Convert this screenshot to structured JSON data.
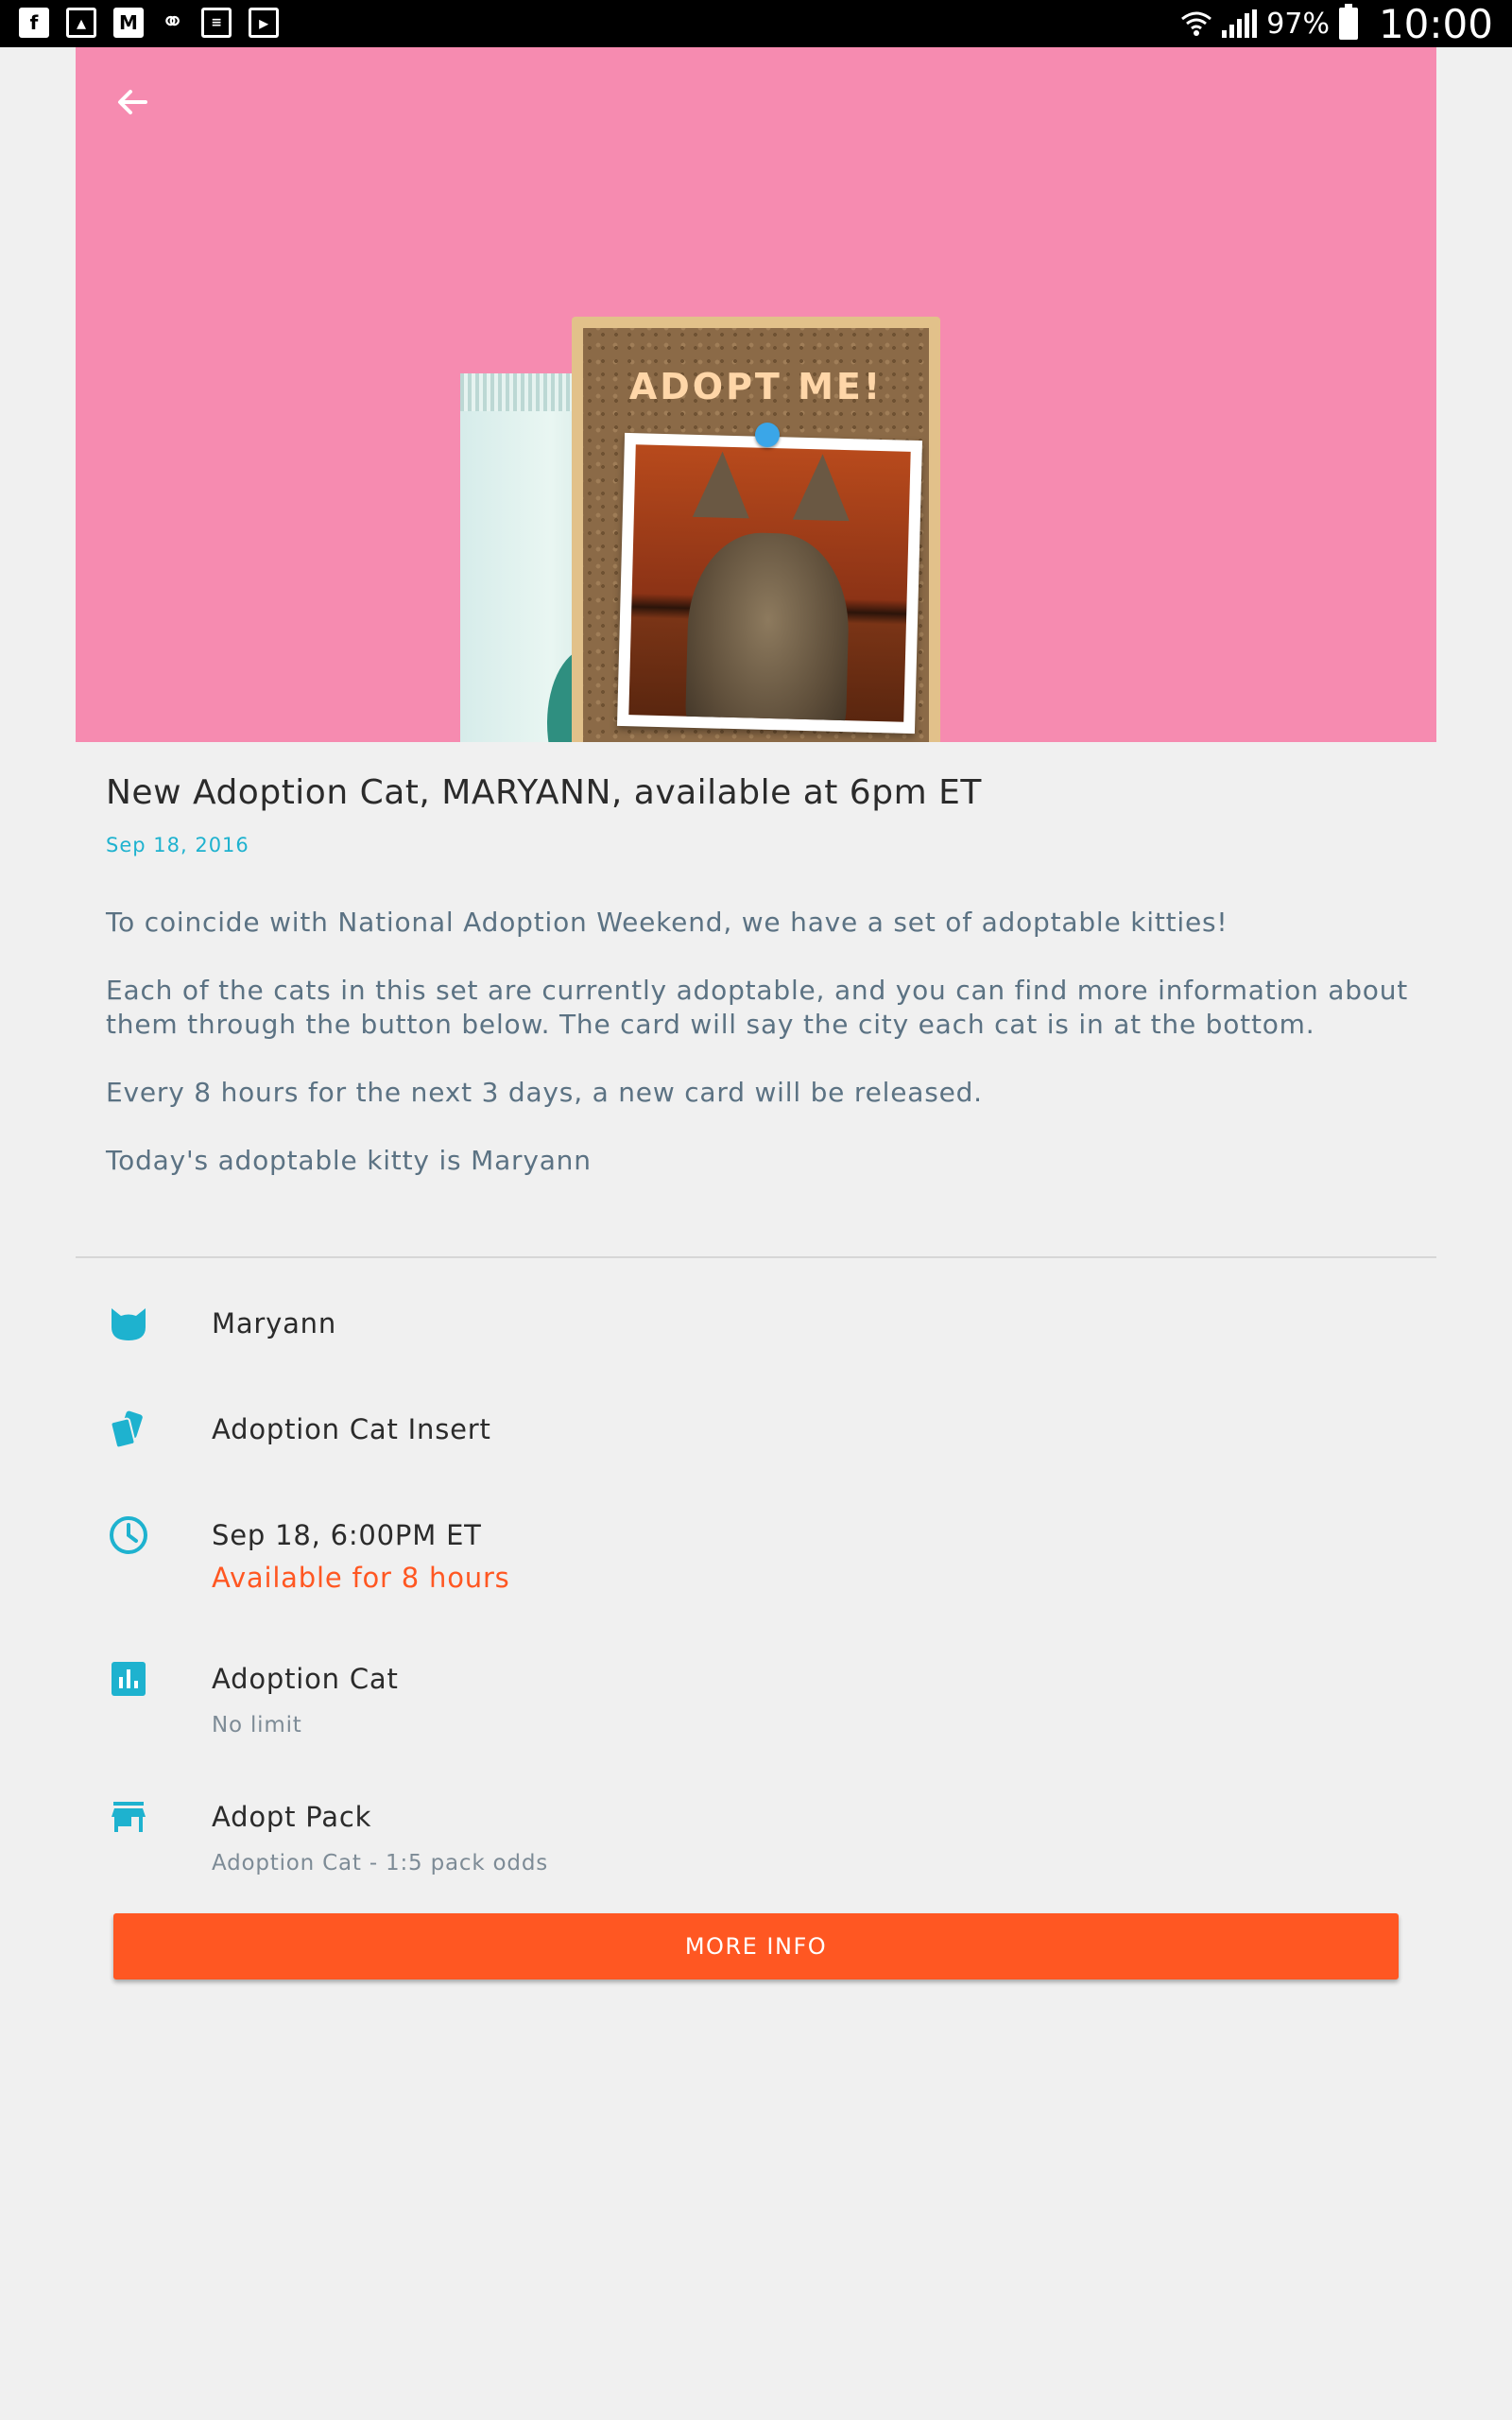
{
  "status_bar": {
    "battery_percent": "97%",
    "time": "10:00",
    "notification_icons": [
      "facebook-icon",
      "image-icon",
      "gmail-icon",
      "bone-icon",
      "document-icon",
      "store-bag-icon"
    ]
  },
  "hero": {
    "card_text": "ADOPT ME!",
    "background_color": "#f68bb0"
  },
  "article": {
    "title": "New Adoption Cat, MARYANN, available at 6pm ET",
    "date": "Sep 18, 2016",
    "paragraphs": [
      "To coincide with National Adoption Weekend, we have a set of adoptable kitties!",
      "Each of the cats in this set are currently adoptable, and you can find more information about them through the button below. The card will say the city each cat is in at the bottom.",
      "Every 8 hours for the next 3 days, a new card will be released.",
      "Today's adoptable kitty is Maryann"
    ]
  },
  "details": [
    {
      "icon": "cat-icon",
      "primary": "Maryann",
      "secondary": ""
    },
    {
      "icon": "cards-icon",
      "primary": "Adoption Cat Insert",
      "secondary": ""
    },
    {
      "icon": "clock-icon",
      "primary": "Sep 18, 6:00PM ET",
      "secondary": "Available for 8 hours"
    },
    {
      "icon": "bar-chart-icon",
      "primary": "Adoption Cat",
      "secondary": "No limit"
    },
    {
      "icon": "store-icon",
      "primary": "Adopt Pack",
      "secondary": "Adoption Cat - 1:5 pack odds"
    }
  ],
  "actions": {
    "more_info_label": "MORE INFO"
  },
  "colors": {
    "accent": "#1eb2cf",
    "action": "#ff5722",
    "body_text": "#5b7283"
  }
}
